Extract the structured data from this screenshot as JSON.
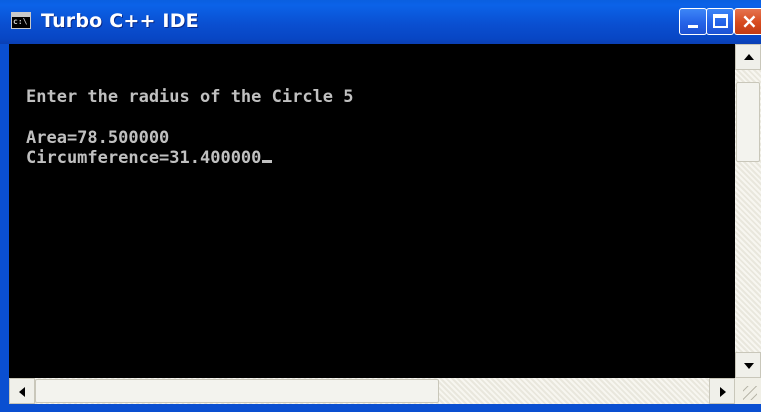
{
  "window": {
    "title": "Turbo C++ IDE",
    "icon": "console-icon",
    "icon_glyph": "c:\\",
    "controls": [
      "minimize",
      "maximize",
      "close"
    ],
    "close_glyph": "×"
  },
  "console": {
    "lines": [
      "Enter the radius of the Circle 5",
      "Area=78.500000",
      "Circumference=31.400000"
    ],
    "cursor": "_"
  },
  "scrollbars": {
    "vertical": "vertical-scrollbar",
    "horizontal": "horizontal-scrollbar"
  },
  "colors": {
    "titlebar": "#0a4fd1",
    "console_bg": "#000000",
    "console_text": "#c0c0c0",
    "close_button": "#d74a1e"
  }
}
